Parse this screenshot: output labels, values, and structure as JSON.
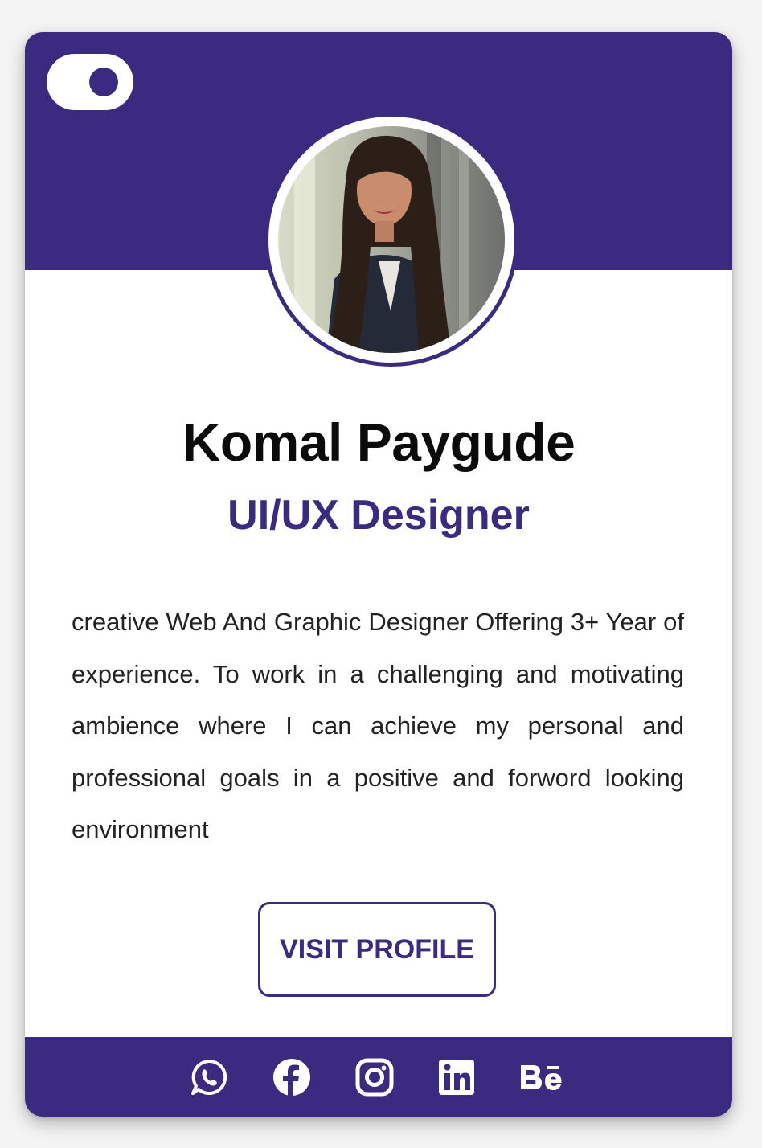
{
  "profile": {
    "name": "Komal Paygude",
    "role": "UI/UX Designer",
    "bio": "creative Web And Graphic Designer Offering 3+ Year of experience. To work in a challenging and motivating ambience where I can achieve my personal and professional goals in a positive and forword looking environment",
    "button_label": "VISIT PROFILE"
  },
  "theme": {
    "accent": "#3a2a80",
    "background": "#ffffff"
  },
  "social_links": [
    {
      "icon": "whatsapp-icon"
    },
    {
      "icon": "facebook-icon"
    },
    {
      "icon": "instagram-icon"
    },
    {
      "icon": "linkedin-icon"
    },
    {
      "icon": "behance-icon"
    }
  ]
}
